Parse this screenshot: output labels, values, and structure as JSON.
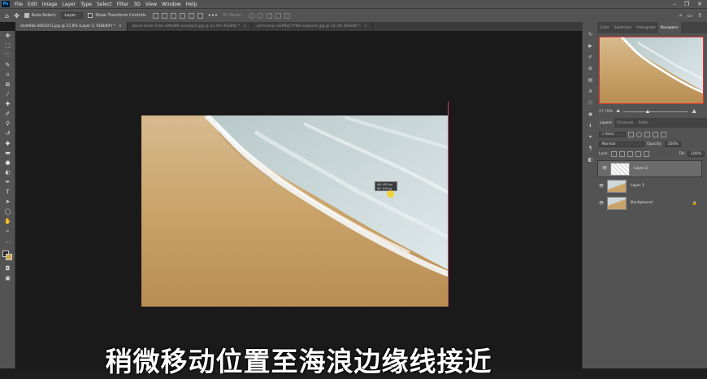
{
  "app": {
    "logo": "Ps"
  },
  "menubar": {
    "items": [
      "File",
      "Edit",
      "Image",
      "Layer",
      "Type",
      "Select",
      "Filter",
      "3D",
      "View",
      "Window",
      "Help"
    ],
    "window_controls": [
      "–",
      "❐",
      "✕"
    ]
  },
  "options": {
    "auto_select_label": "Auto-Select:",
    "auto_select_target": "Layer",
    "transform_label": "Show Transform Controls",
    "mode_3d": "3D Mode:"
  },
  "tabs": [
    {
      "label": "shell9ab-3062011.jpg @ 27,8% (Layer 2, RGB/8#) *",
      "close": "×"
    },
    {
      "label": "david-clode-1Yoh-s09aWR-unsplash.jpg @ 33,3% (RGB/8) *",
      "close": "×"
    },
    {
      "label": "jonh-tanyr-xGPBqF1Yb0-unsplash.jpg @ 33,3% (RGB/8) *",
      "close": "×"
    }
  ],
  "tooltip": {
    "line1": "ΔX: 405 px",
    "line2": "ΔY: 149 px"
  },
  "subtitle": "稍微移动位置至海浪边缘线接近",
  "panel_top": {
    "tabs": [
      "Color",
      "Swatches",
      "Histogram",
      "Navigator"
    ],
    "zoom": "27.78%"
  },
  "layers_panel": {
    "tabs": [
      "Layers",
      "Channels",
      "Paths"
    ],
    "kind": "Kind",
    "blend": "Normal",
    "opacity_label": "Opacity:",
    "opacity": "100%",
    "lock_label": "Lock:",
    "fill_label": "Fill:",
    "fill": "100%",
    "layers": [
      {
        "name": "Layer 2",
        "italic": false,
        "selected": true,
        "locked": false
      },
      {
        "name": "Layer 1",
        "italic": false,
        "selected": false,
        "locked": false
      },
      {
        "name": "Background",
        "italic": true,
        "selected": false,
        "locked": true
      }
    ]
  },
  "colors": {
    "foreground": "#2a2a2a",
    "background": "#d2a54c",
    "accent": "#e03030"
  }
}
